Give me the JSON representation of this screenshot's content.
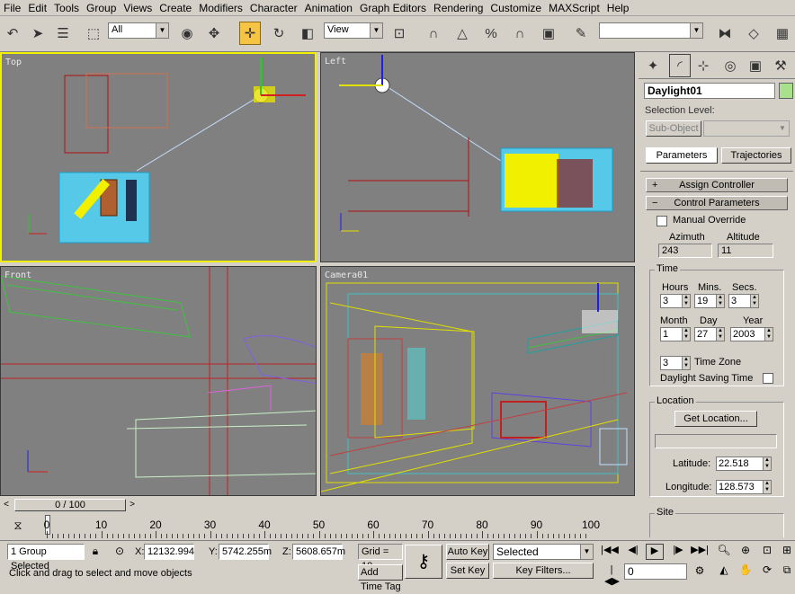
{
  "menu": [
    "File",
    "Edit",
    "Tools",
    "Group",
    "Views",
    "Create",
    "Modifiers",
    "Character",
    "Animation",
    "Graph Editors",
    "Rendering",
    "Customize",
    "MAXScript",
    "Help"
  ],
  "toolbar": {
    "selection_filter": "All",
    "ref_coord": "View",
    "named_selection": ""
  },
  "viewports": {
    "top": "Top",
    "left": "Left",
    "front": "Front",
    "camera": "Camera01"
  },
  "panel": {
    "object_name": "Daylight01",
    "object_color": "#a8e08c",
    "selection_level_label": "Selection Level:",
    "sub_object": "Sub-Object",
    "tab_parameters": "Parameters",
    "tab_trajectories": "Trajectories",
    "assign_controller": "Assign Controller",
    "control_parameters": "Control Parameters",
    "manual_override": "Manual Override",
    "azimuth_label": "Azimuth",
    "altitude_label": "Altitude",
    "azimuth": "243",
    "altitude": "11",
    "time_label": "Time",
    "hours_label": "Hours",
    "mins_label": "Mins.",
    "secs_label": "Secs.",
    "hours": "3",
    "mins": "19",
    "secs": "3",
    "month_label": "Month",
    "day_label": "Day",
    "year_label": "Year",
    "month": "1",
    "day": "27",
    "year": "2003",
    "time_zone": "3",
    "time_zone_label": "Time Zone",
    "dst_label": "Daylight Saving Time",
    "location_label": "Location",
    "get_location": "Get Location...",
    "location_value": "",
    "latitude_label": "Latitude:",
    "latitude": "22.518",
    "longitude_label": "Longitude:",
    "longitude": "128.573",
    "site_label": "Site"
  },
  "timeline": {
    "frame_display": "0 / 100",
    "ticks": [
      "0",
      "10",
      "20",
      "30",
      "40",
      "50",
      "60",
      "70",
      "80",
      "90",
      "100"
    ]
  },
  "status": {
    "selection": "1 Group Selected",
    "x_label": "X:",
    "x": "12132.994",
    "y_label": "Y:",
    "y": "5742.255m",
    "z_label": "Z:",
    "z": "5608.657m",
    "grid": "Grid = 10.",
    "prompt": "Click and drag to select and move objects",
    "add_time_tag": "Add Time Tag",
    "auto_key": "Auto Key",
    "set_key": "Set Key",
    "key_mode": "Selected",
    "key_filters": "Key Filters...",
    "current_frame": "0"
  }
}
